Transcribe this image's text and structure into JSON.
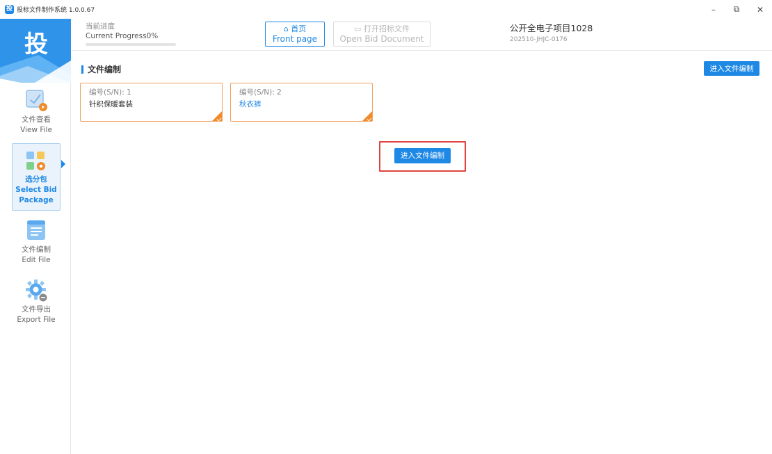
{
  "window": {
    "app_icon": "投",
    "title": "投标文件制作系统 1.0.0.67",
    "controls": {
      "minimize": "–",
      "restore": "⧉",
      "close": "✕"
    }
  },
  "sidebar": {
    "logo": "投",
    "items": [
      {
        "label_cn": "文件查看",
        "label_en": "View File",
        "icon": "view-file-icon",
        "active": false
      },
      {
        "label_cn": "选分包",
        "label_en": "Select Bid Package",
        "icon": "select-package-icon",
        "active": true
      },
      {
        "label_cn": "文件编制",
        "label_en": "Edit File",
        "icon": "edit-file-icon",
        "active": false
      },
      {
        "label_cn": "文件导出",
        "label_en": "Export File",
        "icon": "export-file-icon",
        "active": false
      }
    ]
  },
  "header": {
    "progress": {
      "label_cn": "当前进度",
      "label_en": "Current Progress0%",
      "value": 0
    },
    "home": {
      "icon": "home-icon",
      "label_cn": "首页",
      "label_en": "Front page"
    },
    "open_bid": {
      "icon": "folder-icon",
      "label_cn": "打开招标文件",
      "label_en": "Open Bid Document"
    },
    "project": {
      "name": "公开全电子项目1028",
      "code": "202510-JHJC-0176"
    }
  },
  "main": {
    "section_title": "文件编制",
    "enter_edit_top": "进入文件编制",
    "enter_edit_center": "进入文件编制",
    "packages": [
      {
        "sn": "编号(S/N): 1",
        "name": "针织保暖套装"
      },
      {
        "sn": "编号(S/N): 2",
        "name": "秋衣裤"
      }
    ]
  },
  "colors": {
    "primary": "#1e88e5",
    "card_border": "#f0a15a",
    "highlight": "#e0443f"
  }
}
